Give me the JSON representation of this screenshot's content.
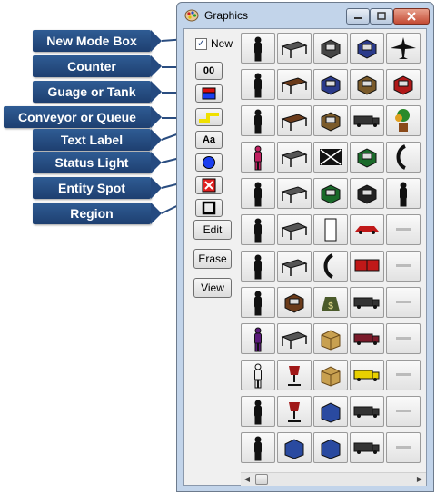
{
  "callouts": {
    "new_mode_box": "New Mode Box",
    "counter": "Counter",
    "gauge_or_tank": "Guage or Tank",
    "conveyor_or_queue": "Conveyor or Queue",
    "text_label": "Text Label",
    "status_light": "Status Light",
    "entity_spot": "Entity Spot",
    "region": "Region"
  },
  "window": {
    "title": "Graphics",
    "icon": "paint-palette-icon",
    "controls": [
      "minimize-icon",
      "maximize-icon",
      "close-icon"
    ]
  },
  "toolbar": {
    "new_checkbox_label": "New",
    "new_checked": true,
    "counter_text": "00",
    "text_label_text": "Aa",
    "edit_label": "Edit",
    "erase_label": "Erase",
    "view_label": "View"
  },
  "colors": {
    "callout_bg": "#1e3f70",
    "gauge_fill": "#1a3ef0",
    "gauge_top": "#d81010",
    "conveyor": "#f0e000",
    "status_light": "#1a3ef0",
    "entity_spot": "#e02020",
    "titlebar": "#c2d4ea"
  },
  "graphics_library": {
    "columns": 5,
    "cells": [
      [
        "person-standing-icon",
        "office-desk-icon",
        "computer-workstation-icon",
        "boxes-on-pallet-icon",
        "airplane-icon"
      ],
      [
        "person-side-icon",
        "wooden-desk-icon",
        "printer-icon",
        "pallet-icon",
        "stacked-pallets-icon"
      ],
      [
        "person-walking-icon",
        "table-icon",
        "copier-icon",
        "hand-truck-icon",
        "potted-plant-icon"
      ],
      [
        "colored-person-icon",
        "desk-with-chair-icon",
        "envelope-icon",
        "forklift-icon",
        "telephone-icon"
      ],
      [
        "worker-icon",
        "cubicle-icon",
        "machine-icon",
        "forklift-side-icon",
        "person-with-sign-icon"
      ],
      [
        "person-back-icon",
        "cubicle-workstation-icon",
        "door-icon",
        "red-car-icon",
        "small-label-icon"
      ],
      [
        "person-sitting-icon",
        "desk-chair-set-icon",
        "phone-handset-icon",
        "red-boxes-icon",
        "small-label-icon"
      ],
      [
        "person-reaching-icon",
        "file-cabinet-icon",
        "money-bag-icon",
        "pickup-truck-icon",
        "small-label-icon"
      ],
      [
        "seated-person-icon",
        "drafting-table-icon",
        "cardboard-box-icon",
        "delivery-van-icon",
        "small-label-icon"
      ],
      [
        "outline-person-icon",
        "red-office-chair-icon",
        "open-box-icon",
        "yellow-truck-icon",
        "small-label-icon"
      ],
      [
        "standing-person-icon",
        "red-stool-icon",
        "blue-container-icon",
        "trailer-truck-icon",
        "small-label-icon"
      ],
      [
        "person-standing-icon",
        "blue-chair-icon",
        "scanner-icon",
        "semi-truck-icon",
        "small-label-icon"
      ]
    ]
  }
}
